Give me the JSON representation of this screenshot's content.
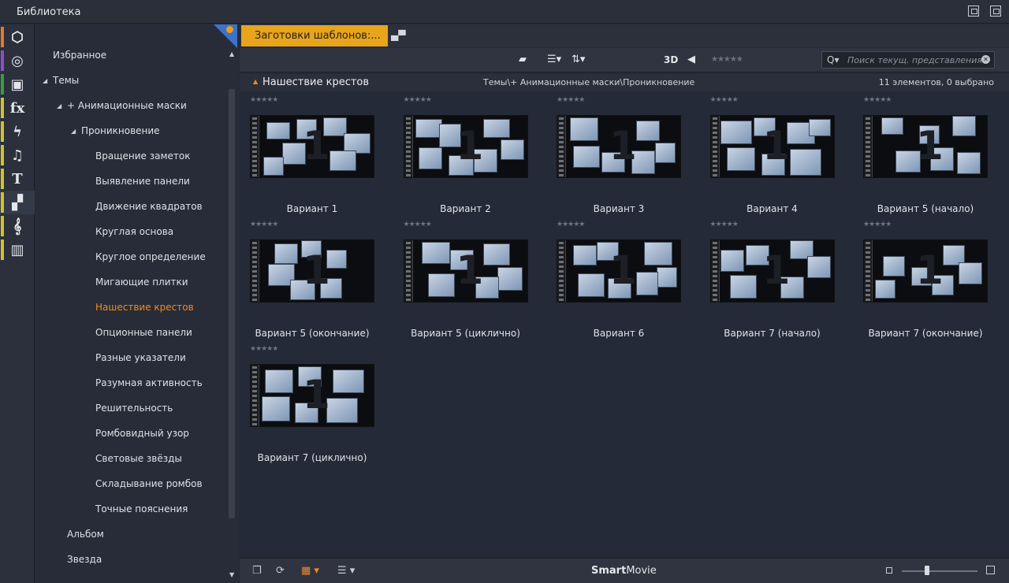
{
  "window": {
    "title": "Библиотека"
  },
  "iconbar": [
    {
      "name": "box-icon",
      "glyph": "⬡",
      "color": "#e37a28"
    },
    {
      "name": "film-reel-icon",
      "glyph": "◎",
      "color": "#8a4fc8"
    },
    {
      "name": "photos-icon",
      "glyph": "▣",
      "color": "#3a9e3a"
    },
    {
      "name": "fx-icon",
      "glyph": "fx",
      "color": "#d3c12c"
    },
    {
      "name": "lightning-icon",
      "glyph": "ϟ",
      "color": "#d3c12c"
    },
    {
      "name": "music-icon",
      "glyph": "♫",
      "color": "#d3c12c"
    },
    {
      "name": "title-icon",
      "glyph": "T",
      "color": "#d3c12c"
    },
    {
      "name": "montage-icon",
      "glyph": "▞",
      "color": "#d3c12c",
      "active": true
    },
    {
      "name": "score-icon",
      "glyph": "𝄞",
      "color": "#d3c12c"
    },
    {
      "name": "piano-icon",
      "glyph": "▥",
      "color": "#d3c12c"
    }
  ],
  "tree": {
    "favorites": "Избранное",
    "themes": "Темы",
    "anim_masks": "+ Анимационные маски",
    "penetration": "Проникновение",
    "items": [
      "Вращение заметок",
      "Выявление панели",
      "Движение квадратов",
      "Круглая основа",
      "Круглое определение",
      "Мигающие плитки",
      "Нашествие крестов",
      "Опционные панели",
      "Разные указатели",
      "Разумная активность",
      "Решительность",
      "Ромбовидный узор",
      "Световые звёзды",
      "Складывание ромбов",
      "Точные пояснения"
    ],
    "active_item": "Нашествие крестов",
    "album": "Альбом",
    "star": "Звезда",
    "accent_color": "#f08a24"
  },
  "tab": {
    "label": "Заготовки шаблонов:..."
  },
  "toolbar": {
    "threed": "3D",
    "stars": "★★★★★",
    "search_placeholder": "Поиск текущ. представления"
  },
  "pathbar": {
    "heading": "Нашествие крестов",
    "path": "Темы\\+ Анимационные маски\\Проникновение",
    "count": "11 элементов, 0 выбрано"
  },
  "items": [
    {
      "label": "Вариант 1",
      "stars": "★★★★★"
    },
    {
      "label": "Вариант 2",
      "stars": "★★★★★"
    },
    {
      "label": "Вариант 3",
      "stars": "★★★★★"
    },
    {
      "label": "Вариант 4",
      "stars": "★★★★★"
    },
    {
      "label": "Вариант 5 (начало)",
      "stars": "★★★★★"
    },
    {
      "label": "Вариант 5 (окончание)",
      "stars": "★★★★★"
    },
    {
      "label": "Вариант 5 (циклично)",
      "stars": "★★★★★"
    },
    {
      "label": "Вариант 6",
      "stars": "★★★★★"
    },
    {
      "label": "Вариант 7 (начало)",
      "stars": "★★★★★"
    },
    {
      "label": "Вариант 7 (окончание)",
      "stars": "★★★★★"
    },
    {
      "label": "Вариант 7 (циклично)",
      "stars": "★★★★★"
    }
  ],
  "thumb_number": "1",
  "bottombar": {
    "brand_bold": "Smart",
    "brand_rest": "Movie"
  }
}
